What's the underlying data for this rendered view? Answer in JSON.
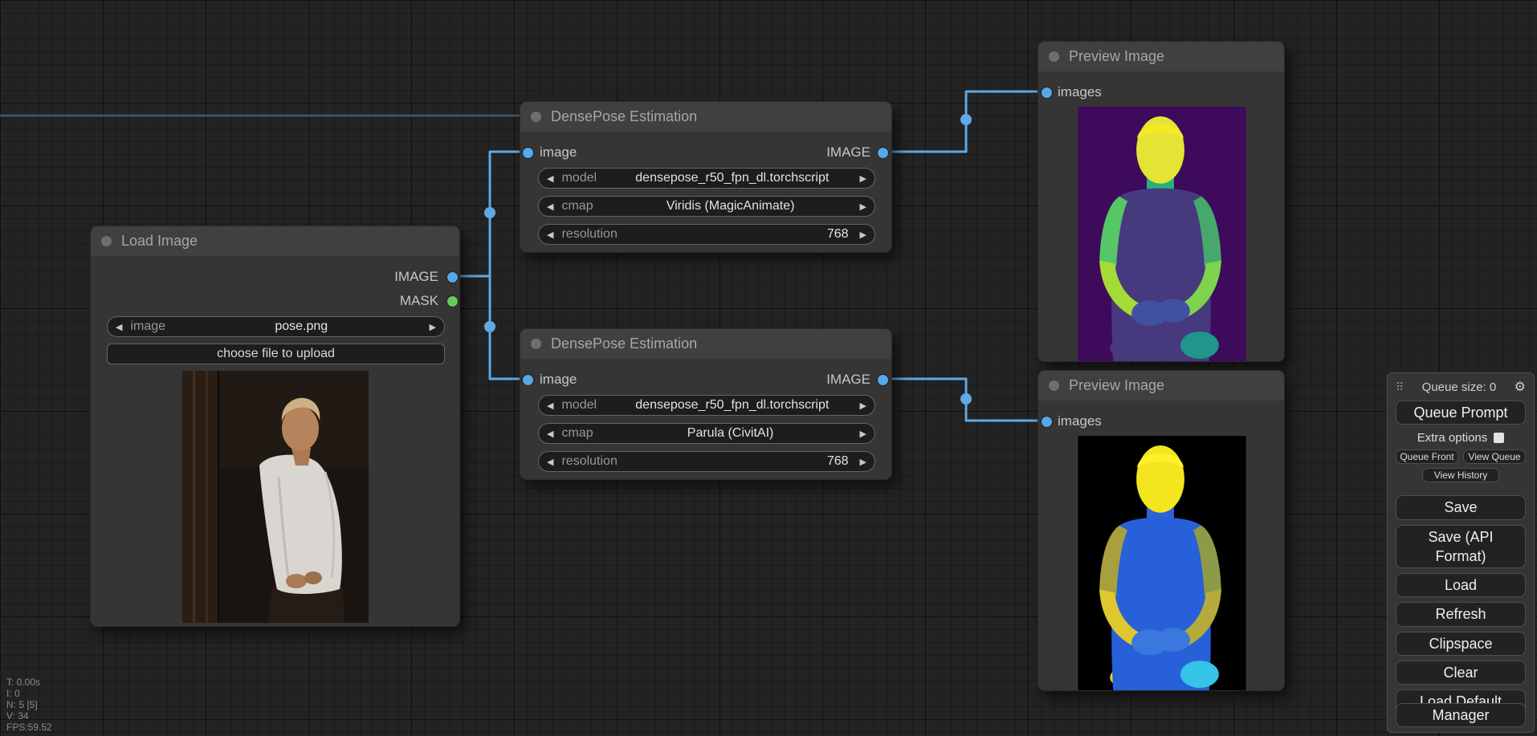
{
  "theme": {
    "link_color": "#5ea9e6",
    "slot_image_color": "#56a8e8",
    "slot_mask_color": "#68c95e"
  },
  "nodes": {
    "load_image": {
      "title": "Load Image",
      "outputs": [
        {
          "label": "IMAGE"
        },
        {
          "label": "MASK"
        }
      ],
      "widgets": {
        "image": {
          "label": "image",
          "value": "pose.png"
        },
        "upload_button": "choose file to upload"
      }
    },
    "densepose_top": {
      "title": "DensePose Estimation",
      "input_label": "image",
      "output_label": "IMAGE",
      "widgets": [
        {
          "label": "model",
          "value": "densepose_r50_fpn_dl.torchscript"
        },
        {
          "label": "cmap",
          "value": "Viridis (MagicAnimate)"
        },
        {
          "label": "resolution",
          "value": "768"
        }
      ]
    },
    "densepose_bottom": {
      "title": "DensePose Estimation",
      "input_label": "image",
      "output_label": "IMAGE",
      "widgets": [
        {
          "label": "model",
          "value": "densepose_r50_fpn_dl.torchscript"
        },
        {
          "label": "cmap",
          "value": "Parula (CivitAI)"
        },
        {
          "label": "resolution",
          "value": "768"
        }
      ]
    },
    "preview_top": {
      "title": "Preview Image",
      "input_label": "images"
    },
    "preview_bottom": {
      "title": "Preview Image",
      "input_label": "images"
    }
  },
  "menu": {
    "queue_size": "Queue size: 0",
    "queue_prompt": "Queue Prompt",
    "extra_options": "Extra options",
    "queue_front": "Queue Front",
    "view_queue": "View Queue",
    "view_history": "View History",
    "save": "Save",
    "save_api": "Save (API Format)",
    "load": "Load",
    "refresh": "Refresh",
    "clipspace": "Clipspace",
    "clear": "Clear",
    "load_default": "Load Default",
    "manager": "Manager"
  },
  "stats": {
    "lines": [
      "T: 0.00s",
      "I: 0",
      "N: 5 [5]",
      "V: 34",
      "FPS:59.52"
    ]
  },
  "figures": {
    "viridis": {
      "bg": "#3e0a5c",
      "head": "#e5e334",
      "head_top": "#f7e825",
      "neck": "#2ab07f",
      "torso": "#47397e",
      "arm_left": "#56c667",
      "arm_right": "#46a96b",
      "forearm_left": "#a5db36",
      "forearm_right": "#7fd34e",
      "hands": "#4150a0",
      "accent": "#1f958b",
      "accent2": "#47397e"
    },
    "parula": {
      "bg": "#000000",
      "head": "#f3e51e",
      "head_top": "#fdf22a",
      "neck": "#2e63d8",
      "torso": "#2760d8",
      "arm_left": "#a89f3f",
      "arm_right": "#8f9a49",
      "forearm_left": "#ddc830",
      "forearm_right": "#b4ab3c",
      "hands": "#3a78dd",
      "accent": "#35c3e8",
      "accent2": "#e8d52b"
    }
  }
}
